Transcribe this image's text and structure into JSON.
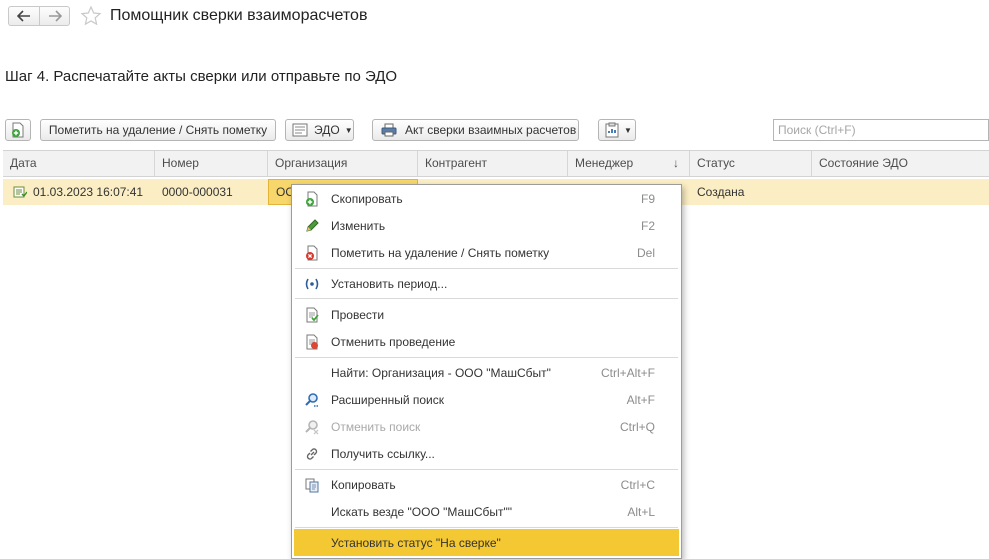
{
  "window": {
    "title": "Помощник сверки взаиморасчетов"
  },
  "step_title": "Шаг 4. Распечатайте акты сверки или отправьте по ЭДО",
  "toolbar": {
    "mark_delete_label": "Пометить на удаление / Снять пометку",
    "edo_label": "ЭДО",
    "act_label": "Акт сверки взаимных расчетов",
    "search_placeholder": "Поиск (Ctrl+F)"
  },
  "table": {
    "columns": [
      "Дата",
      "Номер",
      "Организация",
      "Контрагент",
      "Менеджер",
      "Статус",
      "Состояние ЭДО"
    ],
    "rows": [
      {
        "date": "01.03.2023 16:07:41",
        "number": "0000-000031",
        "organization": "ОО",
        "counterparty": "",
        "manager": "",
        "status": "Создана",
        "edo_state": ""
      }
    ]
  },
  "context_menu": {
    "items": [
      {
        "label": "Скопировать",
        "shortcut": "F9",
        "icon": "copy-doc-icon"
      },
      {
        "label": "Изменить",
        "shortcut": "F2",
        "icon": "pencil-icon"
      },
      {
        "label": "Пометить на удаление / Снять пометку",
        "shortcut": "Del",
        "icon": "mark-delete-icon"
      },
      {
        "label": "Установить период...",
        "shortcut": "",
        "icon": "period-icon"
      },
      {
        "label": "Провести",
        "shortcut": "",
        "icon": "post-icon"
      },
      {
        "label": "Отменить проведение",
        "shortcut": "",
        "icon": "unpost-icon"
      },
      {
        "label": "Найти: Организация - ООО \"МашСбыт\"",
        "shortcut": "Ctrl+Alt+F",
        "icon": ""
      },
      {
        "label": "Расширенный поиск",
        "shortcut": "Alt+F",
        "icon": "search-icon"
      },
      {
        "label": "Отменить поиск",
        "shortcut": "Ctrl+Q",
        "icon": "cancel-search-icon"
      },
      {
        "label": "Получить ссылку...",
        "shortcut": "",
        "icon": "link-icon"
      },
      {
        "label": "Копировать",
        "shortcut": "Ctrl+C",
        "icon": "clipboard-copy-icon"
      },
      {
        "label": "Искать везде \"ООО \"МашСбыт\"\"",
        "shortcut": "Alt+L",
        "icon": ""
      },
      {
        "label": "Установить статус \"На сверке\"",
        "shortcut": "",
        "icon": ""
      }
    ]
  }
}
